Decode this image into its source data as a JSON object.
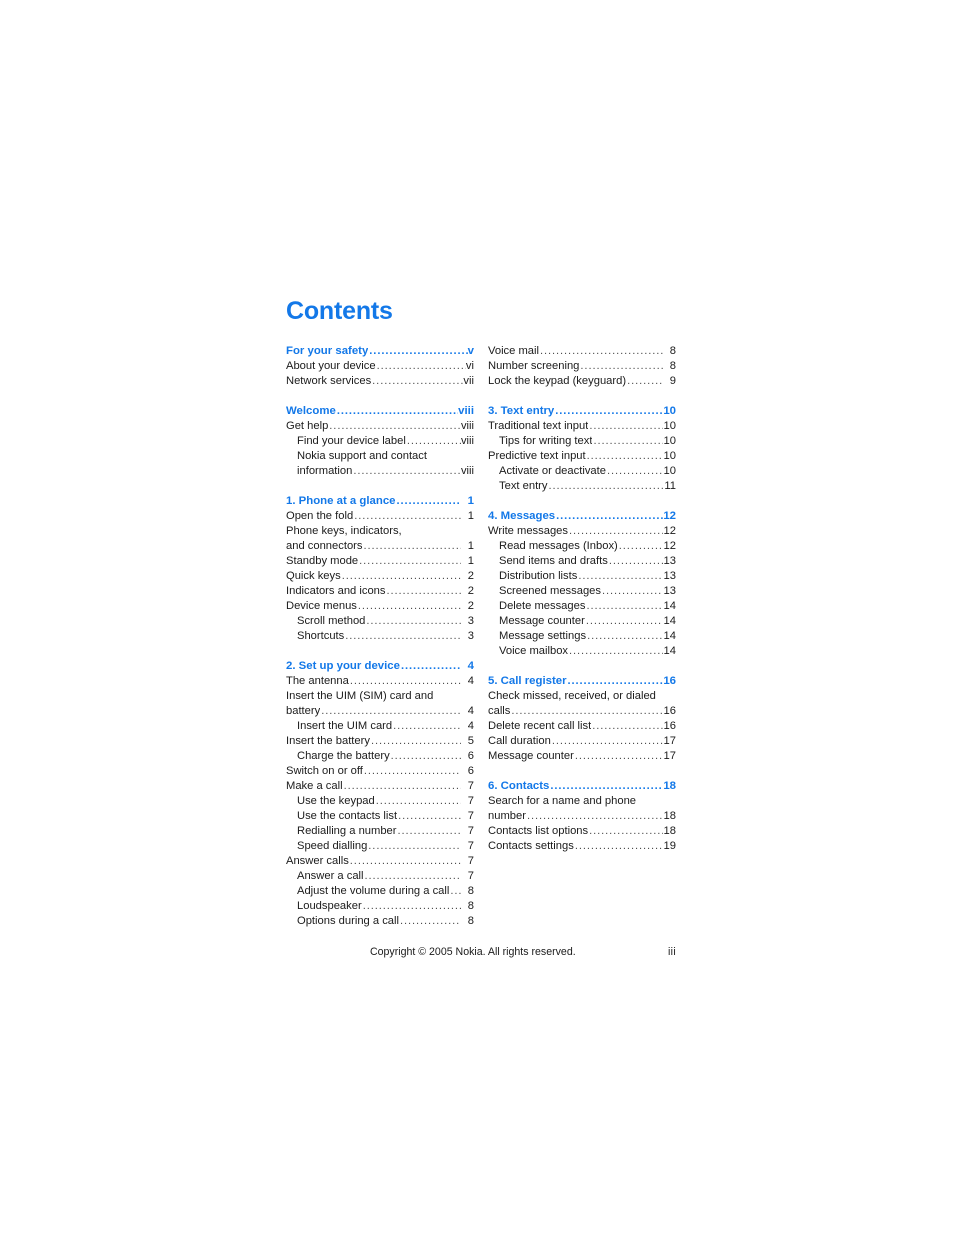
{
  "document": {
    "heading": "Contents",
    "accent_color": "#1378e8",
    "text_color": "#1b1b1b"
  },
  "footer": {
    "copyright": "Copyright © 2005 Nokia. All rights reserved.",
    "folio": "iii"
  },
  "toc": {
    "left_column": [
      {
        "group": 1,
        "entries": [
          {
            "label": "For your safety",
            "page": "v",
            "level": 0,
            "section": true,
            "wrap": false
          },
          {
            "label": "About your device",
            "page": "vi",
            "level": 0,
            "section": false,
            "wrap": false
          },
          {
            "label": "Network services",
            "page": "vii",
            "level": 0,
            "section": false,
            "wrap": false
          }
        ]
      },
      {
        "group": 2,
        "entries": [
          {
            "label": "Welcome",
            "page": "viii",
            "level": 0,
            "section": true,
            "wrap": false
          },
          {
            "label": "Get help",
            "page": "viii",
            "level": 0,
            "section": false,
            "wrap": false
          },
          {
            "label": "Find your device label",
            "page": "viii",
            "level": 1,
            "section": false,
            "wrap": false
          },
          {
            "label": "Nokia support and contact",
            "page": "",
            "level": 1,
            "section": false,
            "wrap": true
          },
          {
            "label": "information",
            "page": "viii",
            "level": 1,
            "section": false,
            "wrap": false
          }
        ]
      },
      {
        "group": 3,
        "entries": [
          {
            "label": "1. Phone at a glance",
            "page": "1",
            "level": 0,
            "section": true,
            "wrap": false
          },
          {
            "label": "Open the fold",
            "page": "1",
            "level": 0,
            "section": false,
            "wrap": false
          },
          {
            "label": "Phone keys, indicators,",
            "page": "",
            "level": 0,
            "section": false,
            "wrap": true
          },
          {
            "label": "and connectors",
            "page": "1",
            "level": 0,
            "section": false,
            "wrap": false
          },
          {
            "label": "Standby mode",
            "page": "1",
            "level": 0,
            "section": false,
            "wrap": false
          },
          {
            "label": "Quick keys",
            "page": "2",
            "level": 0,
            "section": false,
            "wrap": false
          },
          {
            "label": "Indicators and icons",
            "page": "2",
            "level": 0,
            "section": false,
            "wrap": false
          },
          {
            "label": "Device menus",
            "page": "2",
            "level": 0,
            "section": false,
            "wrap": false
          },
          {
            "label": "Scroll method",
            "page": "3",
            "level": 1,
            "section": false,
            "wrap": false
          },
          {
            "label": "Shortcuts",
            "page": "3",
            "level": 1,
            "section": false,
            "wrap": false
          }
        ]
      },
      {
        "group": 4,
        "entries": [
          {
            "label": "2. Set up your device",
            "page": "4",
            "level": 0,
            "section": true,
            "wrap": false
          },
          {
            "label": "The antenna",
            "page": "4",
            "level": 0,
            "section": false,
            "wrap": false
          },
          {
            "label": "Insert the UIM (SIM) card and",
            "page": "",
            "level": 0,
            "section": false,
            "wrap": true
          },
          {
            "label": "battery",
            "page": "4",
            "level": 0,
            "section": false,
            "wrap": false
          },
          {
            "label": "Insert the UIM card",
            "page": "4",
            "level": 1,
            "section": false,
            "wrap": false
          },
          {
            "label": "Insert the battery",
            "page": "5",
            "level": 0,
            "section": false,
            "wrap": false
          },
          {
            "label": "Charge the battery",
            "page": "6",
            "level": 1,
            "section": false,
            "wrap": false
          },
          {
            "label": "Switch on or off",
            "page": "6",
            "level": 0,
            "section": false,
            "wrap": false
          },
          {
            "label": "Make a call",
            "page": "7",
            "level": 0,
            "section": false,
            "wrap": false
          },
          {
            "label": "Use the keypad",
            "page": "7",
            "level": 1,
            "section": false,
            "wrap": false
          },
          {
            "label": "Use the contacts list",
            "page": "7",
            "level": 1,
            "section": false,
            "wrap": false
          },
          {
            "label": "Redialling a number",
            "page": "7",
            "level": 1,
            "section": false,
            "wrap": false
          },
          {
            "label": "Speed dialling",
            "page": "7",
            "level": 1,
            "section": false,
            "wrap": false
          },
          {
            "label": "Answer calls",
            "page": "7",
            "level": 0,
            "section": false,
            "wrap": false
          },
          {
            "label": "Answer a call",
            "page": "7",
            "level": 1,
            "section": false,
            "wrap": false
          },
          {
            "label": "Adjust the volume during a call",
            "page": "8",
            "level": 1,
            "section": false,
            "wrap": false
          },
          {
            "label": "Loudspeaker",
            "page": "8",
            "level": 1,
            "section": false,
            "wrap": false
          },
          {
            "label": "Options during a call",
            "page": "8",
            "level": 1,
            "section": false,
            "wrap": false
          }
        ]
      }
    ],
    "right_column": [
      {
        "group": 1,
        "entries": [
          {
            "label": "Voice mail",
            "page": "8",
            "level": 0,
            "section": false,
            "wrap": false
          },
          {
            "label": "Number screening",
            "page": "8",
            "level": 0,
            "section": false,
            "wrap": false
          },
          {
            "label": "Lock the keypad (keyguard)",
            "page": "9",
            "level": 0,
            "section": false,
            "wrap": false
          }
        ]
      },
      {
        "group": 2,
        "entries": [
          {
            "label": "3. Text entry",
            "page": "10",
            "level": 0,
            "section": true,
            "wrap": false
          },
          {
            "label": "Traditional text input",
            "page": "10",
            "level": 0,
            "section": false,
            "wrap": false
          },
          {
            "label": "Tips for writing text",
            "page": "10",
            "level": 1,
            "section": false,
            "wrap": false
          },
          {
            "label": "Predictive text input",
            "page": "10",
            "level": 0,
            "section": false,
            "wrap": false
          },
          {
            "label": "Activate or deactivate",
            "page": "10",
            "level": 1,
            "section": false,
            "wrap": false
          },
          {
            "label": "Text entry",
            "page": "11",
            "level": 1,
            "section": false,
            "wrap": false
          }
        ]
      },
      {
        "group": 3,
        "entries": [
          {
            "label": "4. Messages",
            "page": "12",
            "level": 0,
            "section": true,
            "wrap": false
          },
          {
            "label": "Write messages",
            "page": "12",
            "level": 0,
            "section": false,
            "wrap": false
          },
          {
            "label": "Read messages (Inbox)",
            "page": "12",
            "level": 1,
            "section": false,
            "wrap": false
          },
          {
            "label": "Send items and drafts",
            "page": "13",
            "level": 1,
            "section": false,
            "wrap": false
          },
          {
            "label": "Distribution lists",
            "page": "13",
            "level": 1,
            "section": false,
            "wrap": false
          },
          {
            "label": "Screened messages",
            "page": "13",
            "level": 1,
            "section": false,
            "wrap": false
          },
          {
            "label": "Delete messages",
            "page": "14",
            "level": 1,
            "section": false,
            "wrap": false
          },
          {
            "label": "Message counter",
            "page": "14",
            "level": 1,
            "section": false,
            "wrap": false
          },
          {
            "label": "Message settings",
            "page": "14",
            "level": 1,
            "section": false,
            "wrap": false
          },
          {
            "label": "Voice mailbox",
            "page": "14",
            "level": 1,
            "section": false,
            "wrap": false
          }
        ]
      },
      {
        "group": 4,
        "entries": [
          {
            "label": "5. Call register",
            "page": "16",
            "level": 0,
            "section": true,
            "wrap": false
          },
          {
            "label": "Check missed, received, or dialed",
            "page": "",
            "level": 0,
            "section": false,
            "wrap": true
          },
          {
            "label": "calls",
            "page": "16",
            "level": 0,
            "section": false,
            "wrap": false
          },
          {
            "label": "Delete recent call list",
            "page": "16",
            "level": 0,
            "section": false,
            "wrap": false
          },
          {
            "label": "Call duration",
            "page": "17",
            "level": 0,
            "section": false,
            "wrap": false
          },
          {
            "label": "Message counter",
            "page": "17",
            "level": 0,
            "section": false,
            "wrap": false
          }
        ]
      },
      {
        "group": 5,
        "entries": [
          {
            "label": "6. Contacts",
            "page": "18",
            "level": 0,
            "section": true,
            "wrap": false
          },
          {
            "label": "Search for a name and phone",
            "page": "",
            "level": 0,
            "section": false,
            "wrap": true
          },
          {
            "label": "number",
            "page": "18",
            "level": 0,
            "section": false,
            "wrap": false
          },
          {
            "label": "Contacts list options",
            "page": "18",
            "level": 0,
            "section": false,
            "wrap": false
          },
          {
            "label": "Contacts settings",
            "page": "19",
            "level": 0,
            "section": false,
            "wrap": false
          }
        ]
      }
    ]
  }
}
